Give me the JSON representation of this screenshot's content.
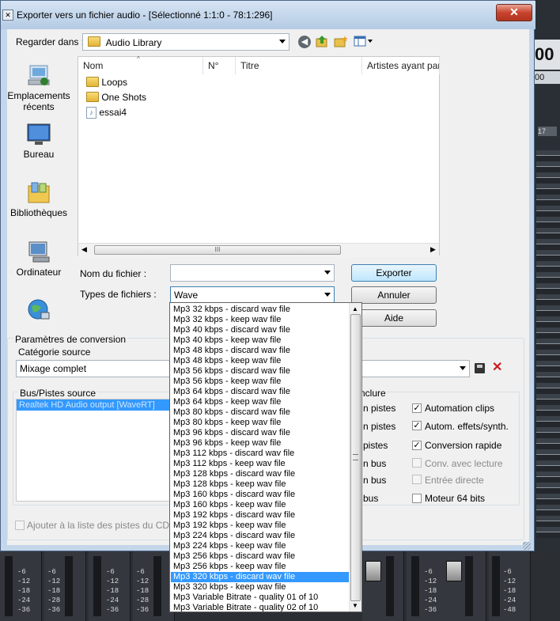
{
  "window": {
    "title": "Exporter vers un fichier audio - [Sélectionné 1:1:0 - 78:1:296]",
    "close_label": "✕"
  },
  "lookin": {
    "label": "Regarder dans :",
    "value": "Audio Library"
  },
  "places": [
    {
      "label": "Emplacements récents",
      "icon": "recent-places-icon"
    },
    {
      "label": "Bureau",
      "icon": "desktop-icon"
    },
    {
      "label": "Bibliothèques",
      "icon": "libraries-icon"
    },
    {
      "label": "Ordinateur",
      "icon": "computer-icon"
    },
    {
      "label": "",
      "icon": "network-icon"
    }
  ],
  "filelist": {
    "columns": [
      "Nom",
      "N°",
      "Titre",
      "Artistes ayant par"
    ],
    "files": [
      {
        "name": "Loops",
        "type": "folder"
      },
      {
        "name": "One Shots",
        "type": "folder"
      },
      {
        "name": "essai4",
        "type": "audio"
      }
    ],
    "scroll_grip": "III"
  },
  "filename": {
    "label": "Nom du fichier :",
    "value": ""
  },
  "filetype": {
    "label": "Types de fichiers :",
    "value": "Wave"
  },
  "buttons": {
    "export": "Exporter",
    "cancel": "Annuler",
    "help": "Aide"
  },
  "conversion": {
    "legend": "Paramètres de conversion",
    "source_category_label": "Catégorie source",
    "source_category_value": "Mixage complet",
    "bus_label": "Bus/Pistes source",
    "bus_item": "Realtek HD Audio output [WaveRT]",
    "include_label": "nclure",
    "include_left": [
      "n pistes",
      "n pistes",
      "pistes",
      "n bus",
      "n bus",
      "bus"
    ],
    "options": [
      {
        "label": "Automation clips",
        "checked": true,
        "enabled": true
      },
      {
        "label": "Autom. effets/synth.",
        "checked": true,
        "enabled": true
      },
      {
        "label": "Conversion rapide",
        "checked": true,
        "enabled": true
      },
      {
        "label": "Conv. avec lecture",
        "checked": false,
        "enabled": false
      },
      {
        "label": "Entrée directe",
        "checked": false,
        "enabled": false
      },
      {
        "label": "Moteur 64 bits",
        "checked": false,
        "enabled": true
      }
    ],
    "cd_label": "Ajouter à la liste des pistes du CD audio"
  },
  "dropdown": {
    "selected": "Mp3 320 kbps - discard wav file",
    "items": [
      "Mp3 32 kbps - discard wav file",
      "Mp3 32 kbps - keep wav file",
      "Mp3 40 kbps - discard wav file",
      "Mp3 40 kbps - keep wav file",
      "Mp3 48 kbps - discard wav file",
      "Mp3 48 kbps - keep wav file",
      "Mp3 56 kbps - discard wav file",
      "Mp3 56 kbps - keep wav file",
      "Mp3 64 kbps - discard wav file",
      "Mp3 64 kbps - keep wav file",
      "Mp3 80 kbps - discard wav file",
      "Mp3 80 kbps - keep wav file",
      "Mp3 96 kbps - discard wav file",
      "Mp3 96 kbps - keep wav file",
      "Mp3 112 kbps - discard wav file",
      "Mp3 112 kbps - keep wav file",
      "Mp3 128 kbps - discard wav file",
      "Mp3 128 kbps - keep wav file",
      "Mp3 160 kbps - discard wav file",
      "Mp3 160 kbps - keep wav file",
      "Mp3 192 kbps - discard wav file",
      "Mp3 192 kbps - keep wav file",
      "Mp3 224 kbps - discard wav file",
      "Mp3 224 kbps - keep wav file",
      "Mp3 256 kbps - discard wav file",
      "Mp3 256 kbps - keep wav file",
      "Mp3 320 kbps - discard wav file",
      "Mp3 320 kbps - keep wav file",
      "Mp3 Variable Bitrate - quality 01 of 10",
      "Mp3 Variable Bitrate - quality 02 of 10"
    ]
  },
  "background": {
    "right_readout": "00",
    "right_readout_small": "00",
    "right_marker": "17",
    "meter_scale": [
      "-6",
      "-12",
      "-18",
      "-24",
      "-28",
      "-36",
      "-48"
    ]
  }
}
